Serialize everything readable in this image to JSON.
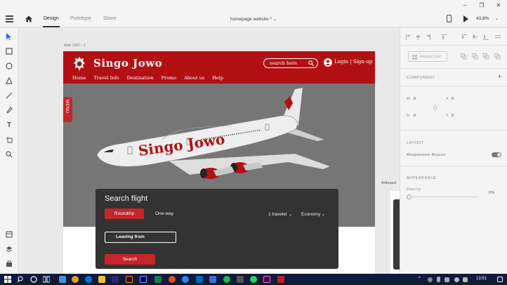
{
  "tabs": {
    "design": "Design",
    "prototype": "Prototype",
    "share": "Share"
  },
  "doc_title": "homepage website * ⌄",
  "zoom": "43,8%",
  "artboard_label": "Web 1920 – 1",
  "artboard_label2": "Artboard",
  "site": {
    "brand": "Singo Jowo",
    "search_placeholder": "search here",
    "login": "Login | Sign-up",
    "menu": [
      "Home",
      "Travel Info",
      "Destination",
      "Promo",
      "About us",
      "Help"
    ],
    "side_tab": "MENU",
    "hero_brand": "Singo Jowo"
  },
  "search_panel": {
    "title": "Search flight",
    "roundtrip": "Roundtrip",
    "oneway": "One-way",
    "traveler": "1 traveler ⌄",
    "economy": "Economy ⌄",
    "leaving": "Leaving from",
    "search": "Search"
  },
  "right_panel": {
    "repeat_grid": "Repeat Grid",
    "component": "COMPONENT",
    "w_label": "W",
    "w_val": "0",
    "x_label": "X",
    "x_val": "0",
    "h_label": "H",
    "h_val": "0",
    "y_label": "Y",
    "y_val": "0",
    "layout": "LAYOUT",
    "responsive_resize": "Responsive Resize",
    "appearance": "APPEARANCE",
    "opacity": "Opacity",
    "opacity_val": "0%"
  },
  "taskbar": {
    "time": "13:51"
  },
  "colors": {
    "brand_red": "#b31014",
    "accent_red": "#c4262a",
    "panel_dark": "#333333"
  }
}
